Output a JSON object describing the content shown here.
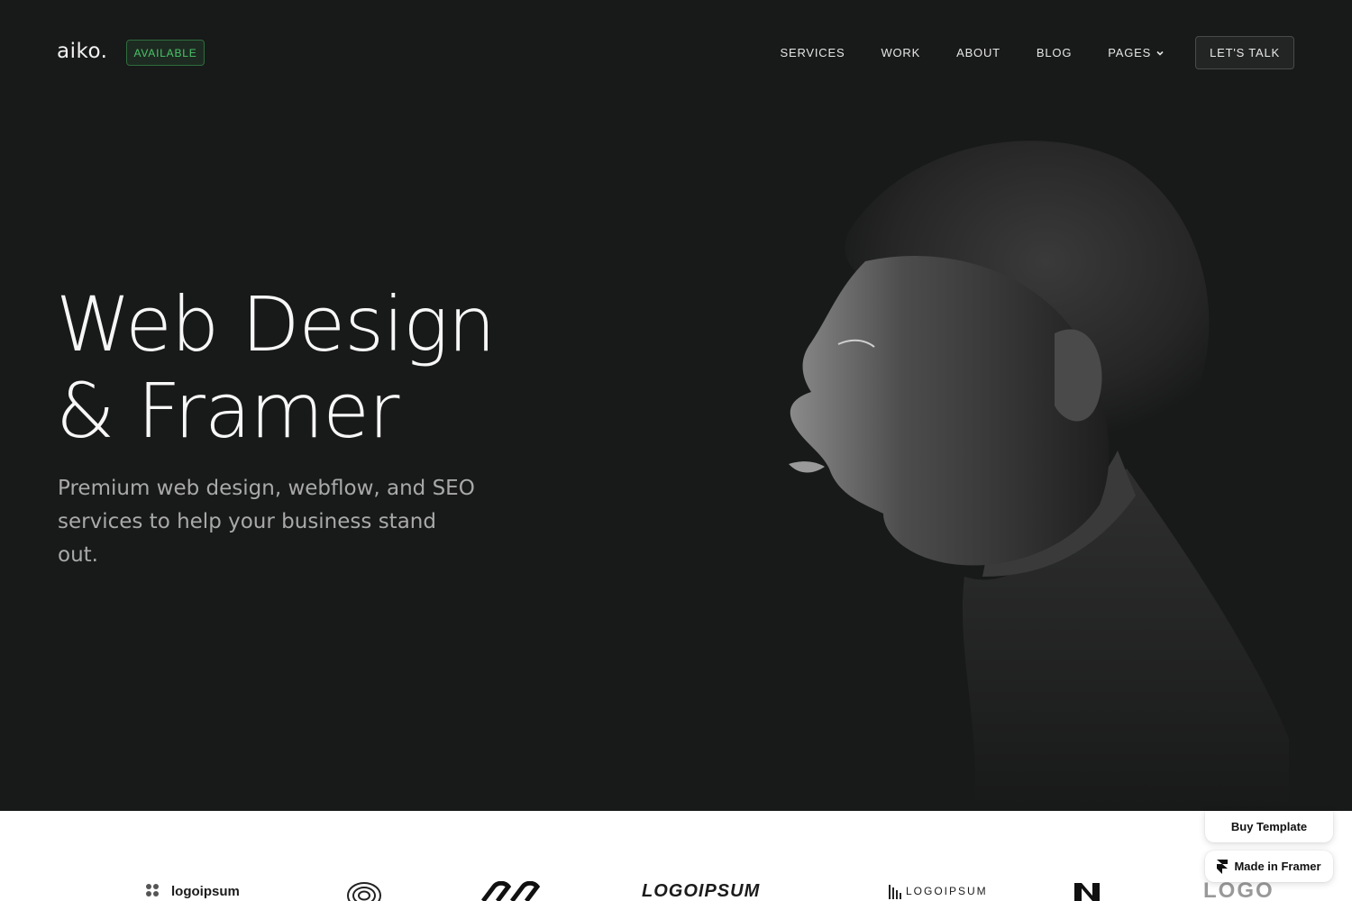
{
  "brand": {
    "logo_text": "aiko.",
    "status_badge": "AVAILABLE"
  },
  "nav": {
    "items": [
      "SERVICES",
      "WORK",
      "ABOUT",
      "BLOG",
      "PAGES"
    ],
    "cta": "LET'S TALK"
  },
  "hero": {
    "headline_line1": "Web Design",
    "headline_line2": "& Framer",
    "subheadline": "Premium web design, webflow, and SEO services to help your business stand out.",
    "image": "portrait-profile-monochrome"
  },
  "client_logos": [
    {
      "text": "logoipsum"
    },
    {
      "text": ""
    },
    {
      "text": ""
    },
    {
      "text": "LOGOIPSUM"
    },
    {
      "text": "LOGOIPSUM"
    },
    {
      "text": ""
    },
    {
      "text": "LOGO"
    }
  ],
  "floating": {
    "buy_template": "Buy Template",
    "made_in_framer": "Made in Framer"
  },
  "colors": {
    "hero_bg": "#181919",
    "badge_green": "#4cc46a",
    "text_primary": "#f7f7f7",
    "text_secondary": "#a9a9a9"
  }
}
